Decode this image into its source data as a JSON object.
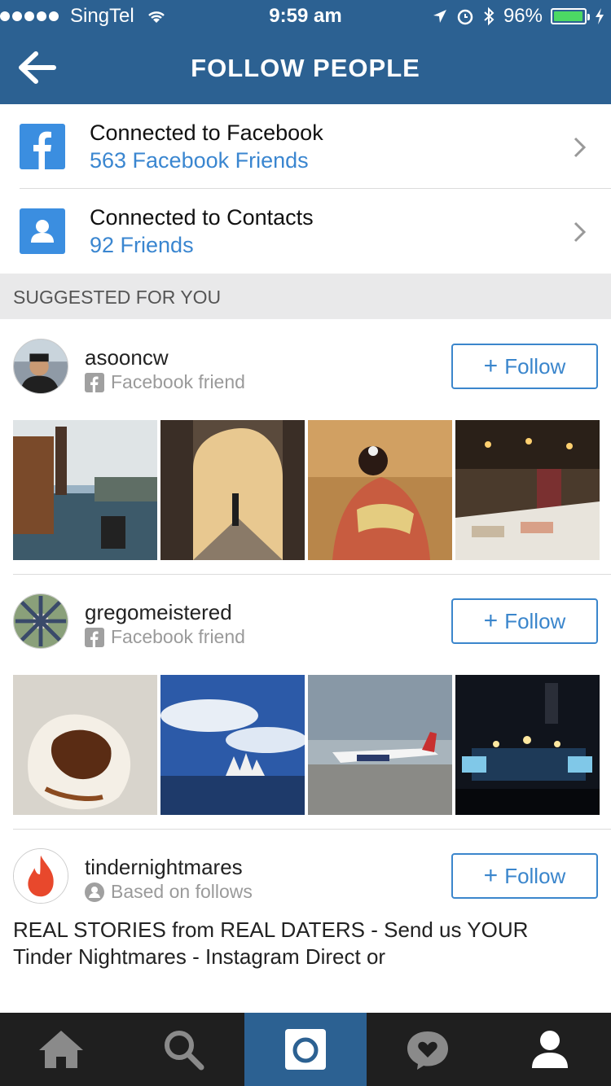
{
  "status": {
    "carrier": "SingTel",
    "time": "9:59 am",
    "battery": "96%",
    "battery_level": 0.96
  },
  "header": {
    "title": "FOLLOW PEOPLE",
    "back_icon": "back-arrow-icon"
  },
  "connections": [
    {
      "title": "Connected to Facebook",
      "subtitle": "563 Facebook Friends",
      "icon": "facebook-icon"
    },
    {
      "title": "Connected to Contacts",
      "subtitle": "92 Friends",
      "icon": "contacts-icon"
    }
  ],
  "section": {
    "title": "SUGGESTED FOR YOU"
  },
  "suggestions": [
    {
      "username": "asooncw",
      "reason": "Facebook friend",
      "reason_icon": "facebook-icon",
      "follow_label": "Follow"
    },
    {
      "username": "gregomeistered",
      "reason": "Facebook friend",
      "reason_icon": "facebook-icon",
      "follow_label": "Follow"
    },
    {
      "username": "tindernightmares",
      "reason": "Based on follows",
      "reason_icon": "person-icon",
      "follow_label": "Follow",
      "bio": "REAL STORIES from REAL DATERS - Send us YOUR Tinder Nightmares - Instagram Direct or"
    }
  ],
  "tabbar": {
    "items": [
      "home-icon",
      "search-icon",
      "camera-icon",
      "activity-icon",
      "profile-icon"
    ],
    "active": "camera-icon"
  },
  "colors": {
    "header": "#2c6192",
    "link": "#3a86d0",
    "follow": "#3b86cc",
    "tabbar": "#1f1f1f",
    "section_bg": "#e9e9ea"
  }
}
